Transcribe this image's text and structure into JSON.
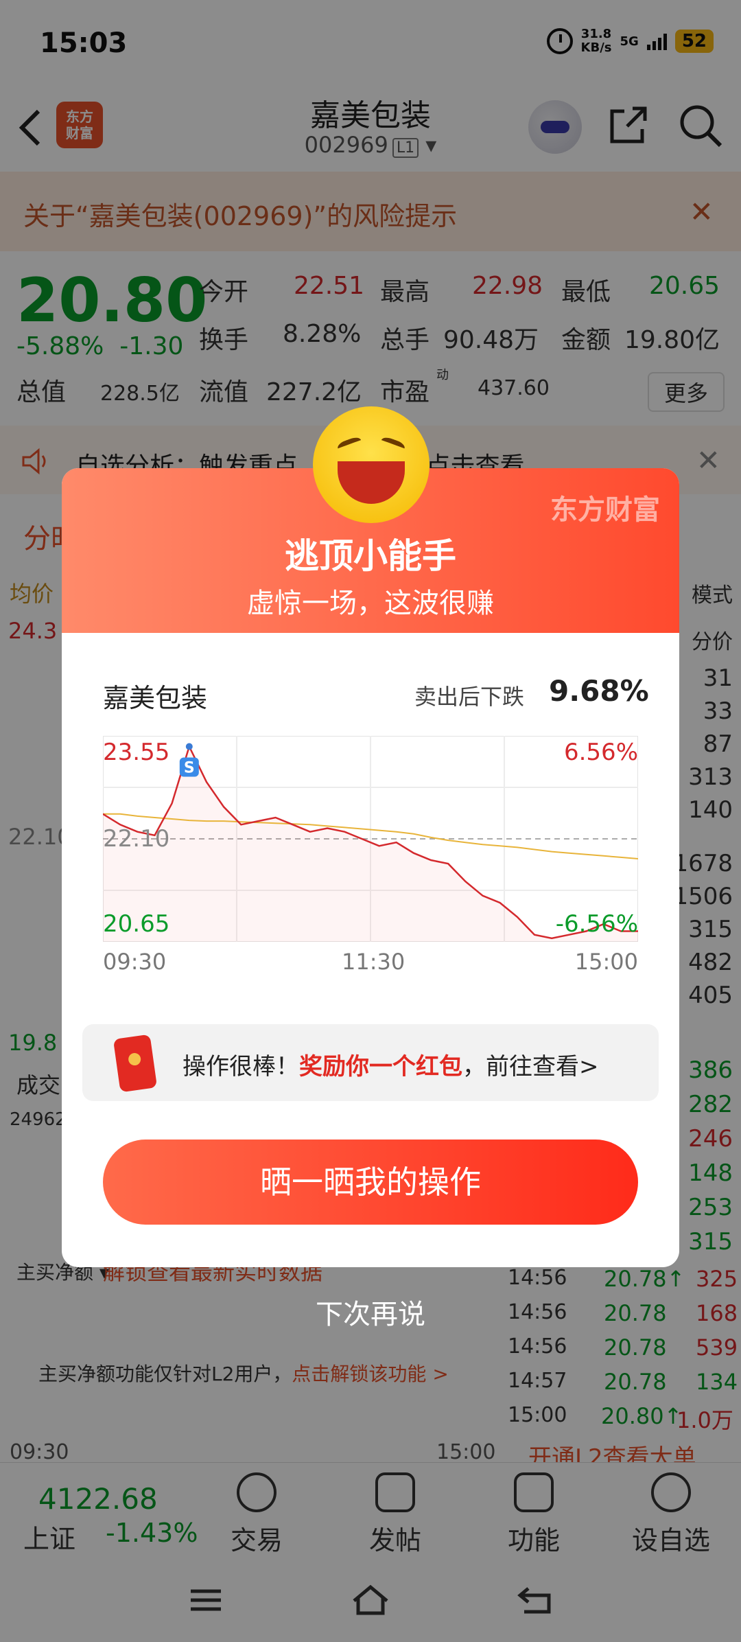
{
  "status": {
    "time": "15:03",
    "net_speed_top": "31.8",
    "net_speed_bottom": "KB/s",
    "network": "5G",
    "battery": "52"
  },
  "header": {
    "logo_line1": "东方",
    "logo_line2": "财富",
    "stock_name": "嘉美包装",
    "stock_code": "002969",
    "level": "L1"
  },
  "risk_banner": {
    "text": "关于“嘉美包装(002969)”的风险提示",
    "close": "✕"
  },
  "quote": {
    "price": "20.80",
    "change_pct": "-5.88%",
    "change_amt": "-1.30",
    "open_label": "今开",
    "open": "22.51",
    "high_label": "最高",
    "high": "22.98",
    "low_label": "最低",
    "low": "20.65",
    "turnover_label": "换手",
    "turnover": "8.28%",
    "volume_label": "总手",
    "volume": "90.48万",
    "amount_label": "金额",
    "amount": "19.80亿",
    "mktcap_label": "总值",
    "mktcap": "228.5亿",
    "float_label": "流值",
    "float": "227.2亿",
    "pe_label": "市盈",
    "pe_sup": "动",
    "pe": "437.60",
    "more": "更多"
  },
  "notice": {
    "text": "自选分析：触发重点",
    "text2": "立即点击查看",
    "close": "✕"
  },
  "background": {
    "tab": "分时",
    "avg_label": "均价",
    "top_left": "24.3",
    "mid_left": "22.10",
    "bottom_left": "19.8",
    "vol_label": "成交",
    "vol_val": "24962",
    "main_buy": "主买净额 ▾",
    "unlock": "解锁查看最新实时数据",
    "mode": "模式",
    "price_col": "分价",
    "right_top": [
      "31",
      "33",
      "87",
      "313",
      "140",
      "1678",
      "1506",
      "315",
      "482",
      "405"
    ],
    "right_vols": [
      "386",
      "282",
      "246",
      "148",
      "253",
      "315"
    ],
    "trades": [
      {
        "time": "14:56",
        "price": "20.78↑",
        "vol": "325"
      },
      {
        "time": "14:56",
        "price": "20.78",
        "vol": "168"
      },
      {
        "time": "14:56",
        "price": "20.78",
        "vol": "539"
      },
      {
        "time": "14:57",
        "price": "20.78",
        "vol": "134"
      },
      {
        "time": "15:00",
        "price": "20.80↑",
        "vol": "1.0万"
      }
    ],
    "l2_note": "主买净额功能仅针对L2用户，",
    "l2_link": "点击解锁该功能 >",
    "time_start": "09:30",
    "time_end": "15:00",
    "l2_ad": "开通L2查看大单"
  },
  "tabbar": {
    "index_price": "4122.68",
    "index_name": "上证",
    "index_chg": "-1.43%",
    "items": [
      "交易",
      "发帖",
      "功能",
      "设自选"
    ]
  },
  "modal": {
    "brand": "东方财富",
    "title": "逃顶小能手",
    "subtitle": "虚惊一场，这波很赚",
    "stock": "嘉美包装",
    "drop_label": "卖出后下跌",
    "drop_value": "9.68%",
    "redpacket_prefix": "操作很棒！",
    "redpacket_highlight": "奖励你一个红包",
    "redpacket_suffix": "，前往查看>",
    "share_button": "晒一晒我的操作",
    "later": "下次再说"
  },
  "chart_data": {
    "type": "line",
    "x_labels": [
      "09:30",
      "11:30",
      "15:00"
    ],
    "ylim": [
      20.65,
      23.55
    ],
    "y_left_labels": [
      "23.55",
      "22.10",
      "20.65"
    ],
    "y_right_labels": [
      "6.56%",
      "-6.56%"
    ],
    "reference": 22.1,
    "sell_marker": "S",
    "series": [
      {
        "values": [
          22.45,
          22.3,
          22.2,
          22.15,
          22.6,
          23.4,
          22.9,
          22.55,
          22.3,
          22.35,
          22.4,
          22.3,
          22.2,
          22.25,
          22.2,
          22.1,
          22.0,
          22.05,
          21.9,
          21.8,
          21.75,
          21.5,
          21.3,
          21.2,
          21.0,
          20.75,
          20.7,
          20.75,
          20.8,
          20.9,
          20.8,
          20.8
        ]
      },
      {
        "values": [
          22.45,
          22.45,
          22.42,
          22.4,
          22.38,
          22.36,
          22.35,
          22.35,
          22.34,
          22.33,
          22.32,
          22.31,
          22.3,
          22.28,
          22.26,
          22.24,
          22.22,
          22.2,
          22.17,
          22.12,
          22.08,
          22.05,
          22.02,
          22.0,
          21.98,
          21.95,
          21.92,
          21.9,
          21.88,
          21.86,
          21.84,
          21.82
        ]
      }
    ]
  }
}
